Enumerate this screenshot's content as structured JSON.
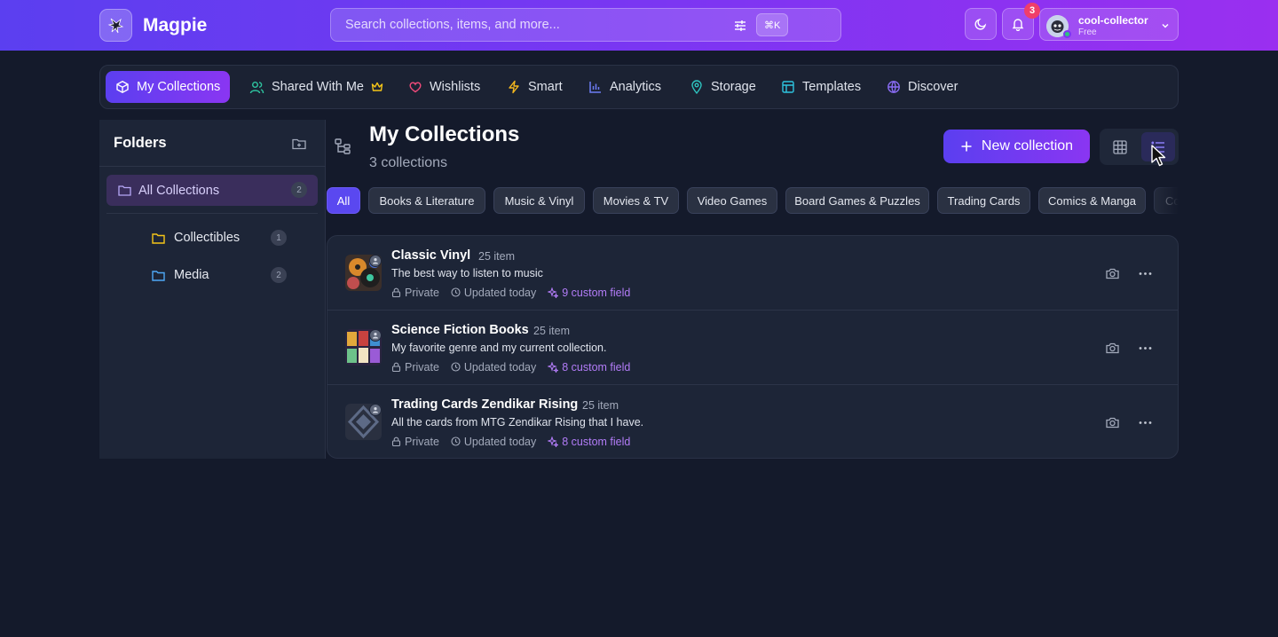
{
  "header": {
    "app_name": "Magpie",
    "search_placeholder": "Search collections, items, and more...",
    "search_shortcut": "⌘K",
    "notification_count": "3",
    "user": {
      "name": "cool-collector",
      "plan": "Free"
    }
  },
  "nav": {
    "tabs": [
      {
        "label": "My Collections",
        "icon": "cube-icon",
        "active": true
      },
      {
        "label": "Shared With Me",
        "icon": "users-icon"
      },
      {
        "label": "Wishlists",
        "icon": "heart-icon"
      },
      {
        "label": "Smart",
        "icon": "bolt-icon"
      },
      {
        "label": "Analytics",
        "icon": "bar-chart-icon"
      },
      {
        "label": "Storage",
        "icon": "map-pin-icon"
      },
      {
        "label": "Templates",
        "icon": "layout-icon"
      },
      {
        "label": "Discover",
        "icon": "globe-icon"
      }
    ]
  },
  "sidebar": {
    "title": "Folders",
    "all_label": "All Collections",
    "all_count": "2",
    "folders": [
      {
        "label": "Collectibles",
        "count": "1",
        "color": "#f5c518"
      },
      {
        "label": "Media",
        "count": "2",
        "color": "#4ea8f5"
      }
    ]
  },
  "main": {
    "title": "My Collections",
    "subtitle": "3 collections",
    "new_button": "New collection",
    "filters": [
      "All",
      "Books & Literature",
      "Music & Vinyl",
      "Movies & TV",
      "Video Games",
      "Board Games & Puzzles",
      "Trading Cards",
      "Comics & Manga",
      "Co"
    ],
    "collections": [
      {
        "title": "Classic Vinyl",
        "count": "25 item",
        "description": "The best way to listen to music",
        "visibility": "Private",
        "updated": "Updated today",
        "custom": "9 custom field"
      },
      {
        "title": "Science Fiction Books",
        "count": "25 item",
        "description": "My favorite genre and my current collection.",
        "visibility": "Private",
        "updated": "Updated today",
        "custom": "8 custom field"
      },
      {
        "title": "Trading Cards Zendikar Rising",
        "count": "25 item",
        "description": "All the cards from MTG Zendikar Rising that I have.",
        "visibility": "Private",
        "updated": "Updated today",
        "custom": "8 custom field"
      }
    ]
  },
  "colors": {
    "accent": "#5b3ff0",
    "accent2": "#9a2ff0",
    "background": "#141a2b",
    "custom_field": "#b27cf7"
  }
}
